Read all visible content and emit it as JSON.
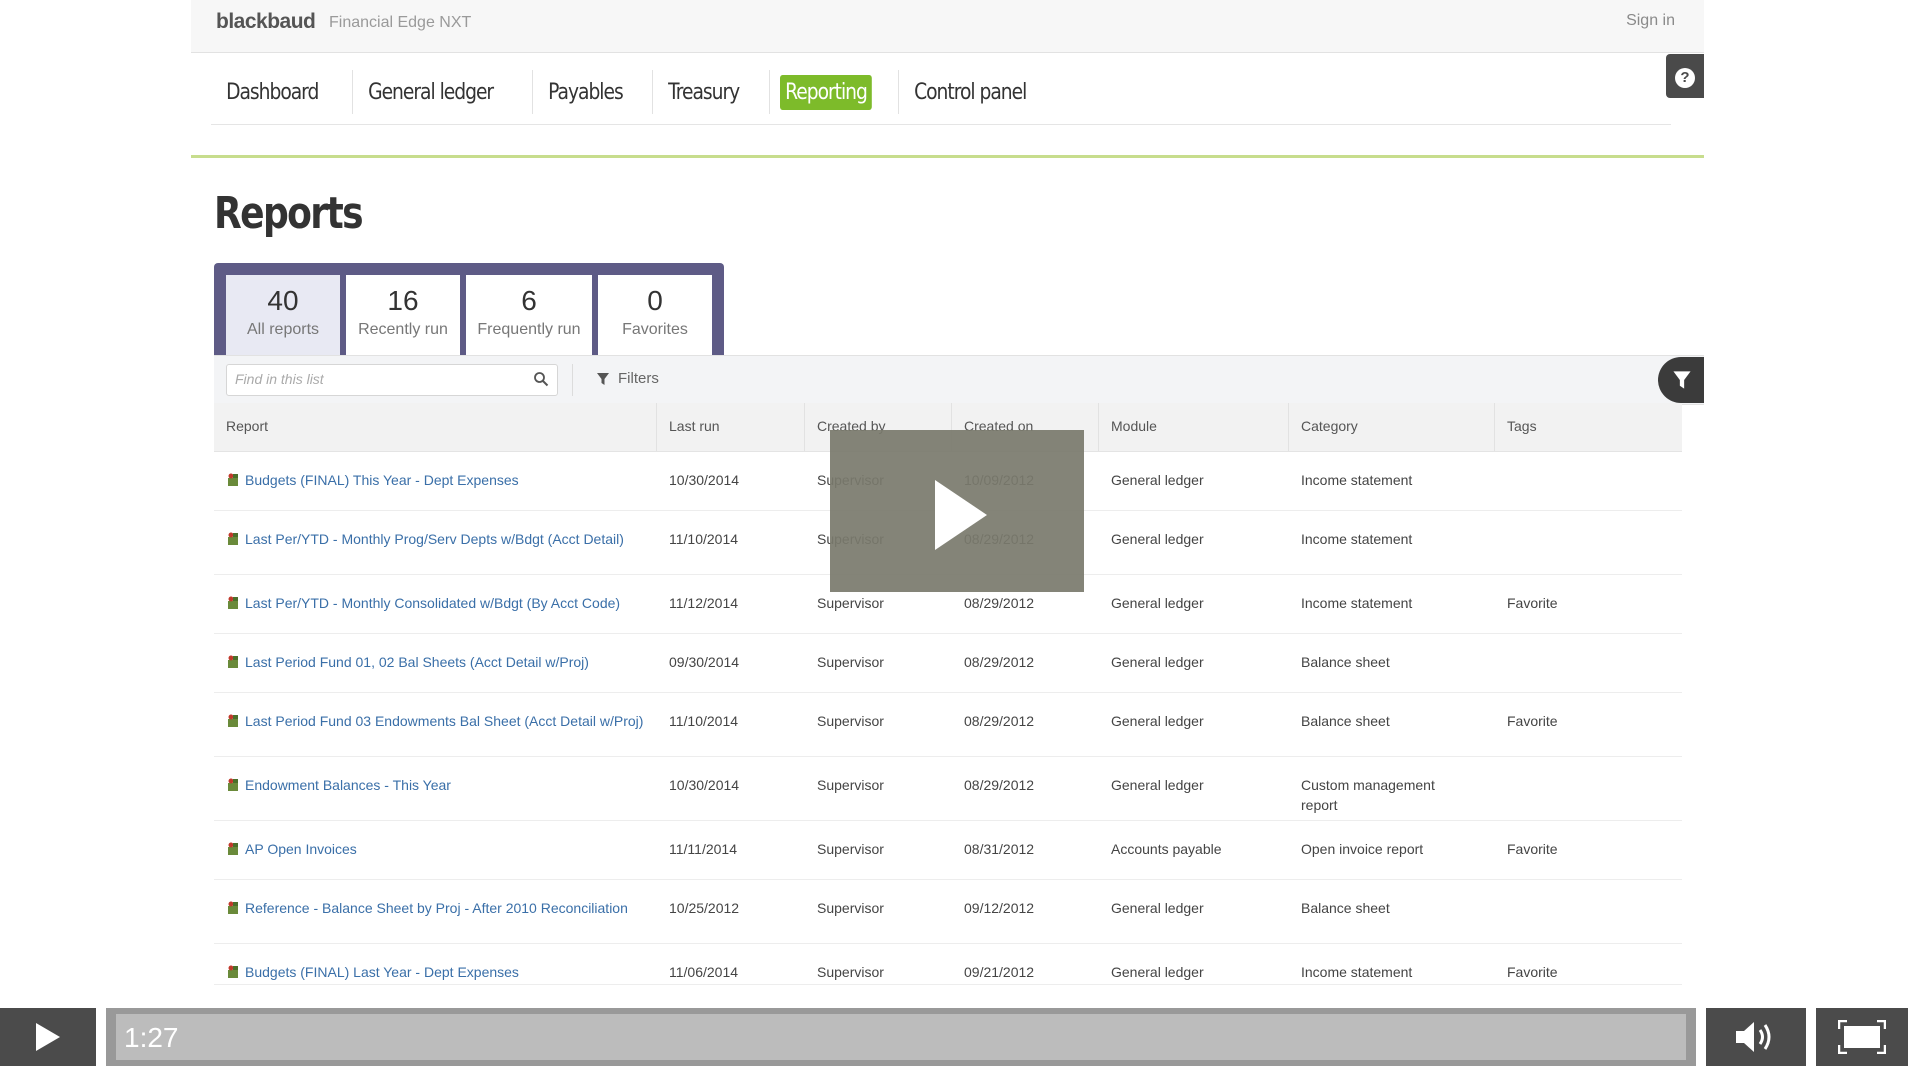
{
  "header": {
    "brand": "blackbaud",
    "product": "Financial Edge NXT",
    "signin": "Sign in"
  },
  "nav": {
    "items": [
      {
        "label": "Dashboard",
        "active": false
      },
      {
        "label": "General ledger",
        "active": false
      },
      {
        "label": "Payables",
        "active": false
      },
      {
        "label": "Treasury",
        "active": false
      },
      {
        "label": "Reporting",
        "active": true
      },
      {
        "label": "Control panel",
        "active": false
      }
    ],
    "active_color": "#7dbb2a"
  },
  "page": {
    "title": "Reports"
  },
  "tiles": [
    {
      "count": "40",
      "label": "All reports",
      "active": true
    },
    {
      "count": "16",
      "label": "Recently run",
      "active": false
    },
    {
      "count": "6",
      "label": "Frequently run",
      "active": false
    },
    {
      "count": "0",
      "label": "Favorites",
      "active": false
    }
  ],
  "toolbar": {
    "search_placeholder": "Find in this list",
    "filters_label": "Filters"
  },
  "table": {
    "columns": [
      "Report",
      "Last run",
      "Created by",
      "Created on",
      "Module",
      "Category",
      "Tags"
    ],
    "rows": [
      {
        "report": "Budgets (FINAL) This Year - Dept Expenses",
        "last_run": "10/30/2014",
        "created_by": "Supervisor",
        "created_on": "10/09/2012",
        "module": "General ledger",
        "category": "Income statement",
        "tags": ""
      },
      {
        "report": "Last Per/YTD - Monthly Prog/Serv Depts w/Bdgt (Acct Detail)",
        "last_run": "11/10/2014",
        "created_by": "Supervisor",
        "created_on": "08/29/2012",
        "module": "General ledger",
        "category": "Income statement",
        "tags": ""
      },
      {
        "report": "Last Per/YTD - Monthly Consolidated w/Bdgt (By Acct Code)",
        "last_run": "11/12/2014",
        "created_by": "Supervisor",
        "created_on": "08/29/2012",
        "module": "General ledger",
        "category": "Income statement",
        "tags": "Favorite"
      },
      {
        "report": "Last Period Fund 01, 02 Bal Sheets (Acct Detail w/Proj)",
        "last_run": "09/30/2014",
        "created_by": "Supervisor",
        "created_on": "08/29/2012",
        "module": "General ledger",
        "category": "Balance sheet",
        "tags": ""
      },
      {
        "report": "Last Period Fund 03 Endowments Bal Sheet (Acct Detail w/Proj)",
        "last_run": "11/10/2014",
        "created_by": "Supervisor",
        "created_on": "08/29/2012",
        "module": "General ledger",
        "category": "Balance sheet",
        "tags": "Favorite"
      },
      {
        "report": "Endowment Balances - This Year",
        "last_run": "10/30/2014",
        "created_by": "Supervisor",
        "created_on": "08/29/2012",
        "module": "General ledger",
        "category": "Custom management report",
        "tags": ""
      },
      {
        "report": "AP Open Invoices",
        "last_run": "11/11/2014",
        "created_by": "Supervisor",
        "created_on": "08/31/2012",
        "module": "Accounts payable",
        "category": "Open invoice report",
        "tags": "Favorite"
      },
      {
        "report": "Reference - Balance Sheet by Proj - After 2010 Reconciliation",
        "last_run": "10/25/2012",
        "created_by": "Supervisor",
        "created_on": "09/12/2012",
        "module": "General ledger",
        "category": "Balance sheet",
        "tags": ""
      },
      {
        "report": "Budgets (FINAL) Last Year - Dept Expenses",
        "last_run": "11/06/2014",
        "created_by": "Supervisor",
        "created_on": "09/21/2012",
        "module": "General ledger",
        "category": "Income statement",
        "tags": "Favorite"
      }
    ]
  },
  "video": {
    "time": "1:27",
    "progress": 0.0
  }
}
